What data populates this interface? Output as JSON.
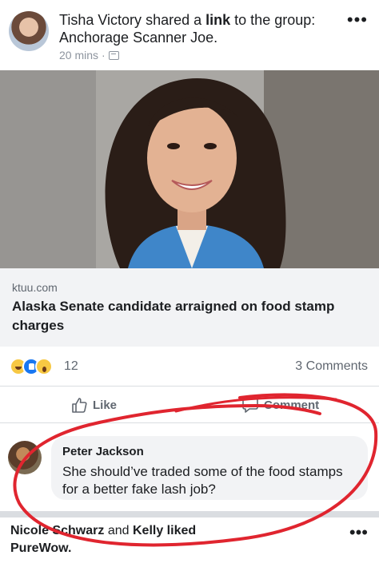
{
  "post": {
    "author": "Tisha Victory",
    "action_text": "shared a",
    "link_word": "link",
    "to_text": "to the group:",
    "group_name": "Anchorage Scanner Joe.",
    "time": "20 mins",
    "separator": "·",
    "more": "•••"
  },
  "link_preview": {
    "domain": "ktuu.com",
    "title": "Alaska Senate candidate arraigned on food stamp charges"
  },
  "engagement": {
    "reaction_count": "12",
    "comment_count": "3 Comments"
  },
  "actions": {
    "like": "Like",
    "comment": "Comment"
  },
  "comment": {
    "author": "Peter Jackson",
    "text": "She should’ve traded some of the food stamps for a better fake lash job?"
  },
  "next_post": {
    "author": "Nicole Schwarz",
    "conjunction": "and",
    "rest": "Kelly liked",
    "line2": "PureWow.",
    "more": "•••"
  },
  "colors": {
    "annotation": "#e0252f",
    "link_blue": "#1877f2",
    "meta_gray": "#8d949e"
  }
}
